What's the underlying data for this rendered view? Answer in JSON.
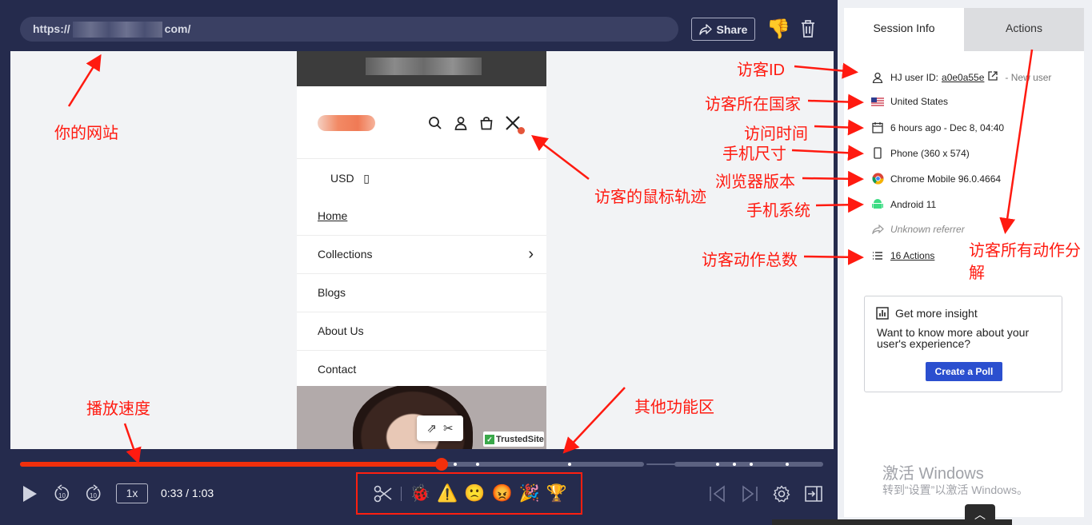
{
  "player": {
    "url_prefix": "https://",
    "url_suffix": "com/",
    "share_label": "Share",
    "speed": "1x",
    "time": "0:33 / 1:03",
    "progress": 0.525
  },
  "site": {
    "currency": "USD",
    "currency_glyph": "▯",
    "menu": [
      {
        "label": "Home"
      },
      {
        "label": "Collections"
      },
      {
        "label": "Blogs"
      },
      {
        "label": "About Us"
      },
      {
        "label": "Contact"
      }
    ],
    "trusted_badge": "TrustedSite"
  },
  "reactions": [
    "🐞",
    "⚠️",
    "🙁",
    "😡",
    "🎉",
    "🏆"
  ],
  "sidebar": {
    "tab_session": "Session Info",
    "tab_actions": "Actions",
    "user_id_label": "HJ user ID:",
    "user_id": "a0e0a55e",
    "user_status": "- New user",
    "country": "United States",
    "visit_time": "6 hours ago - Dec 8, 04:40",
    "device": "Phone (360 x 574)",
    "browser": "Chrome Mobile 96.0.4664",
    "os": "Android 11",
    "referrer": "Unknown referrer",
    "actions_count": "16 Actions",
    "card": {
      "title": "Get more insight",
      "text": "Want to know more about your user's experience?",
      "button": "Create a Poll"
    }
  },
  "watermark": {
    "line1": "激活 Windows",
    "line2": "转到“设置”以激活 Windows。"
  },
  "annotations": {
    "website": "你的网站",
    "visitor_id": "访客ID",
    "country": "访客所在国家",
    "visit_time": "访问时间",
    "phone_size": "手机尺寸",
    "browser": "浏览器版本",
    "os": "手机系统",
    "actions_total": "访客动作总数",
    "mouse_track": "访客的鼠标轨迹",
    "all_actions_line1": "访客所有动作分",
    "all_actions_line2": "解",
    "speed": "播放速度",
    "other": "其他功能区"
  }
}
